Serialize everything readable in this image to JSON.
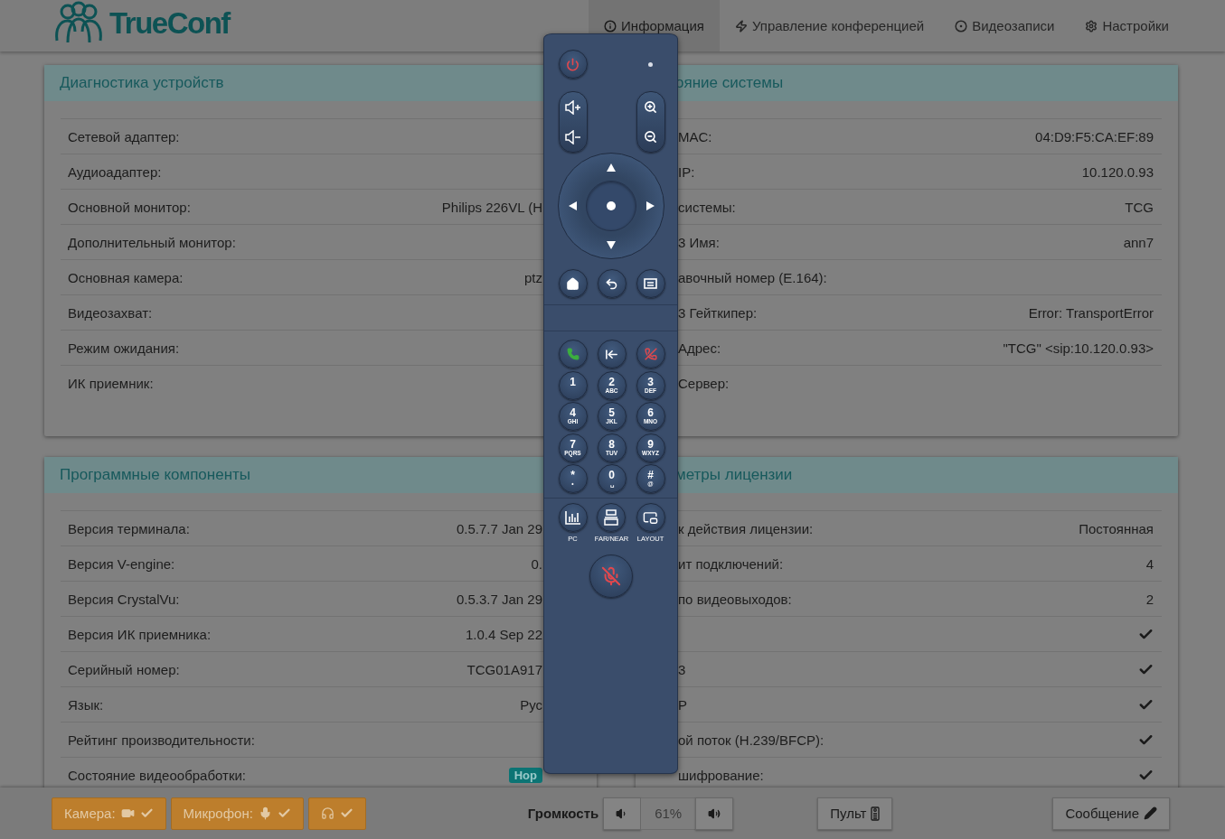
{
  "header": {
    "logo": "TrueConf",
    "nav": [
      {
        "label": "Информация",
        "selected": true
      },
      {
        "label": "Управление конференцией",
        "selected": false
      },
      {
        "label": "Видеозаписи",
        "selected": false
      },
      {
        "label": "Настройки",
        "selected": false
      }
    ]
  },
  "panels": [
    {
      "title": "Диагностика устройств",
      "rows": [
        {
          "kind": "text",
          "label": "Сетевой адаптер:"
        },
        {
          "kind": "text",
          "label": "Аудиоадаптер:"
        },
        {
          "kind": "text",
          "label": "Основной монитор:",
          "value": "Philips 226VL (H"
        },
        {
          "kind": "text",
          "label": "Дополнительный монитор:"
        },
        {
          "kind": "text",
          "label": "Основная камера:",
          "value": "ptz"
        },
        {
          "kind": "text",
          "label": "Видеозахват:"
        },
        {
          "kind": "text",
          "label": "Режим ожидания:"
        },
        {
          "kind": "text",
          "label": "ИК приемник:"
        }
      ]
    },
    {
      "title": "ояние системы",
      "rows": [
        {
          "kind": "text",
          "label": "MAC:",
          "value": "04:D9:F5:CA:EF:89"
        },
        {
          "kind": "text",
          "label": "IP:",
          "value": "10.120.0.93"
        },
        {
          "kind": "text",
          "label": "системы:",
          "value": "TCG"
        },
        {
          "kind": "text",
          "label": "3 Имя:",
          "value": "ann7"
        },
        {
          "kind": "text",
          "label": "авочный номер (E.164):"
        },
        {
          "kind": "text",
          "label": "3 Гейткипер:",
          "value": "Error: TransportError"
        },
        {
          "kind": "text",
          "label": "Адрес:",
          "value": "\"TCG\" <sip:10.120.0.93>"
        },
        {
          "kind": "text",
          "label": "Сервер:"
        }
      ]
    },
    {
      "title": "Программные компоненты",
      "rows": [
        {
          "kind": "text",
          "label": "Версия терминала:",
          "value": "0.5.7.7 Jan 29"
        },
        {
          "kind": "text",
          "label": "Версия V-engine:",
          "value": "0."
        },
        {
          "kind": "text",
          "label": "Версия CrystalVu:",
          "value": "0.5.3.7 Jan 29"
        },
        {
          "kind": "text",
          "label": "Версия ИК приемника:",
          "value": "1.0.4 Sep 22"
        },
        {
          "kind": "text",
          "label": "Серийный номер:",
          "value": "TCG01A917"
        },
        {
          "kind": "text",
          "label": "Язык:",
          "value": "Рус"
        },
        {
          "kind": "text",
          "label": "Рейтинг производительности:"
        },
        {
          "kind": "badge",
          "label": "Состояние видеообработки:",
          "value": "Нор"
        }
      ]
    },
    {
      "title": "метры лицензии",
      "rows": [
        {
          "kind": "text",
          "label": "к действия лицензии:",
          "value": "Постоянная"
        },
        {
          "kind": "text",
          "label": "ит подключений:",
          "value": "4"
        },
        {
          "kind": "text",
          "label": "по видеовыходов:",
          "value": "2"
        },
        {
          "kind": "check",
          "checked": true
        },
        {
          "kind": "check",
          "label": "3",
          "checked": true
        },
        {
          "kind": "check",
          "label": "P",
          "checked": true
        },
        {
          "kind": "check",
          "label": "ой поток (H.239/BFCP):",
          "checked": true
        },
        {
          "kind": "check",
          "label": "шифрование:",
          "checked": true
        }
      ]
    }
  ],
  "remote": {
    "keys": [
      {
        "digit": "1"
      },
      {
        "digit": "2",
        "letters": "ABC"
      },
      {
        "digit": "3",
        "letters": "DEF"
      },
      {
        "digit": "4",
        "letters": "GHI"
      },
      {
        "digit": "5",
        "letters": "JKL"
      },
      {
        "digit": "6",
        "letters": "MNO"
      },
      {
        "digit": "7",
        "letters": "PQRS"
      },
      {
        "digit": "8",
        "letters": "TUV"
      },
      {
        "digit": "9",
        "letters": "WXYZ"
      },
      {
        "digit": "*",
        "letters": "•"
      },
      {
        "digit": "0",
        "letters": "␣"
      },
      {
        "digit": "#",
        "letters": "@"
      }
    ],
    "function_keys": [
      {
        "label": "PC"
      },
      {
        "label": "FAR/NEAR"
      },
      {
        "label": "LAYOUT"
      }
    ]
  },
  "footer": {
    "status_buttons": [
      {
        "label": "Камера:",
        "checked": true
      },
      {
        "label": "Микрофон:",
        "checked": true
      },
      {
        "checked": true
      }
    ],
    "volume": {
      "label": "Громкость",
      "reading": "61%"
    },
    "remote_button": "Пульт",
    "message_button": "Сообщение"
  }
}
